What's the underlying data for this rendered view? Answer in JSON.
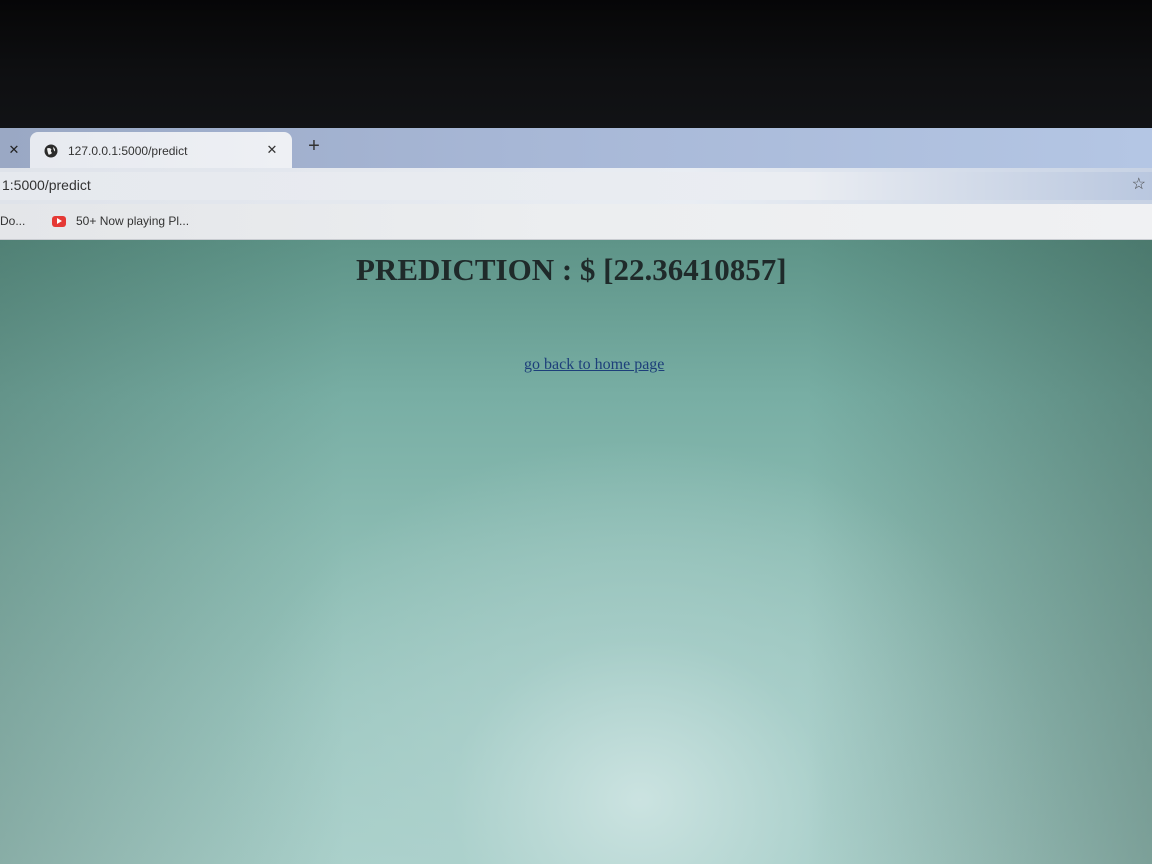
{
  "browser": {
    "tab": {
      "title": "127.0.0.1:5000/predict"
    },
    "address": {
      "url": "1:5000/predict"
    },
    "bookmarks": [
      {
        "label": "Do..."
      },
      {
        "label": "50+ Now playing Pl..."
      }
    ]
  },
  "page": {
    "prediction_text": "PREDICTION : $ [22.36410857]",
    "home_link_label": "go back to home page"
  },
  "icons": {
    "close": "close-icon",
    "globe": "globe-icon",
    "new_tab": "plus-icon",
    "bookmark": "star-icon",
    "youtube": "youtube-icon"
  }
}
